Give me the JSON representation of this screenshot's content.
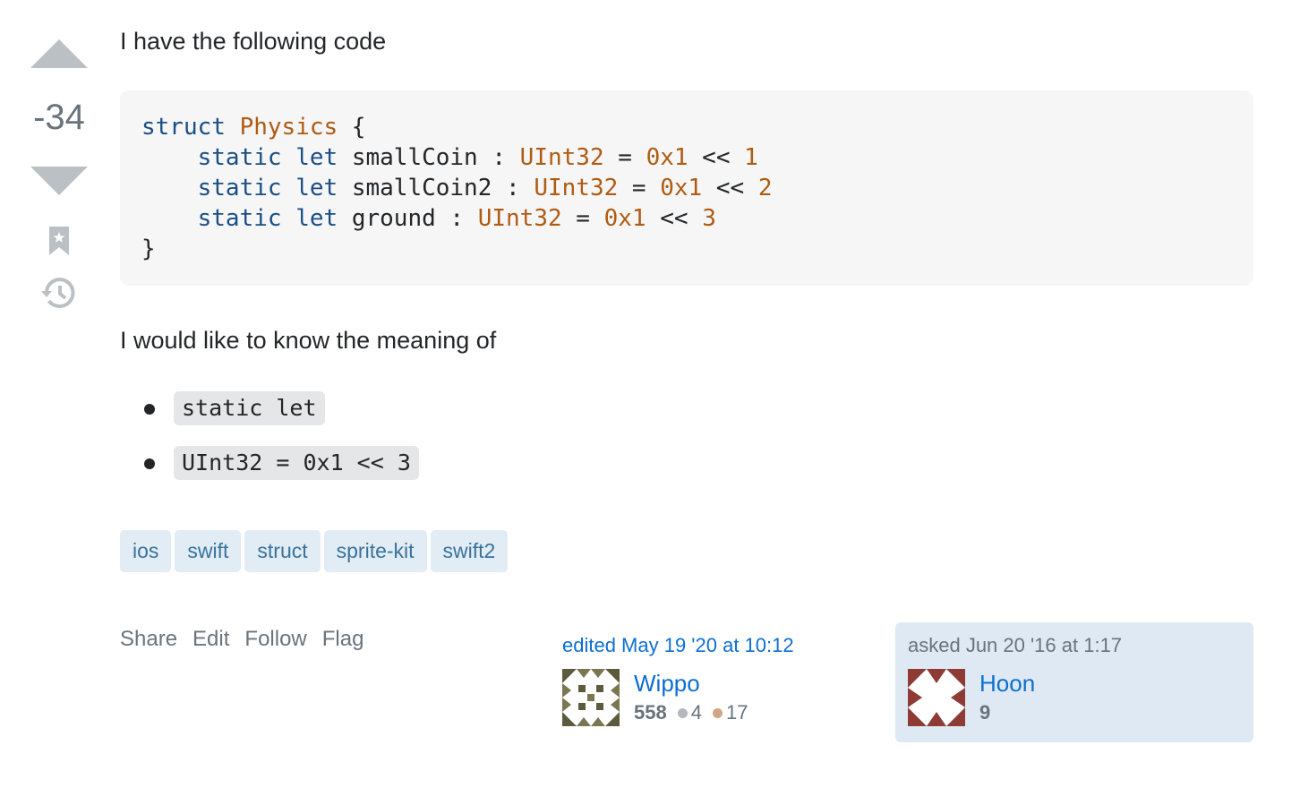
{
  "vote": {
    "count": "-34"
  },
  "question": {
    "intro": "I have the following code",
    "code_lines": {
      "line1": {
        "kw": "struct",
        "type": "Physics",
        "rest": " {"
      },
      "line2": {
        "indent": "    ",
        "kw1": "static",
        "kw2": "let",
        "name": " smallCoin : ",
        "type": "UInt32",
        "eq": " = ",
        "hex": "0x1",
        "op": " << ",
        "num": "1"
      },
      "line3": {
        "indent": "    ",
        "kw1": "static",
        "kw2": "let",
        "name": " smallCoin2 : ",
        "type": "UInt32",
        "eq": " = ",
        "hex": "0x1",
        "op": " << ",
        "num": "2"
      },
      "line4": {
        "indent": "    ",
        "kw1": "static",
        "kw2": "let",
        "name": " ground : ",
        "type": "UInt32",
        "eq": " = ",
        "hex": "0x1",
        "op": " << ",
        "num": "3"
      },
      "line5": "}"
    },
    "question_text": "I would like to know the meaning of",
    "bullets": [
      "static let",
      "UInt32 = 0x1 << 3"
    ],
    "tags": [
      "ios",
      "swift",
      "struct",
      "sprite-kit",
      "swift2"
    ]
  },
  "post_menu": {
    "share": "Share",
    "edit": "Edit",
    "follow": "Follow",
    "flag": "Flag"
  },
  "editor": {
    "action": "edited May 19 '20 at 10:12",
    "name": "Wippo",
    "reputation": "558",
    "silver_badges": "4",
    "bronze_badges": "17"
  },
  "owner": {
    "action": "asked Jun 20 '16 at 1:17",
    "name": "Hoon",
    "reputation": "9"
  },
  "colors": {
    "tag_bg": "#e1ecf4",
    "tag_text": "#39739d",
    "link": "#0c6fd1",
    "owner_card_bg": "#dfe9f3",
    "silver_badge": "#b4b8bc",
    "bronze_badge": "#d1a684"
  }
}
